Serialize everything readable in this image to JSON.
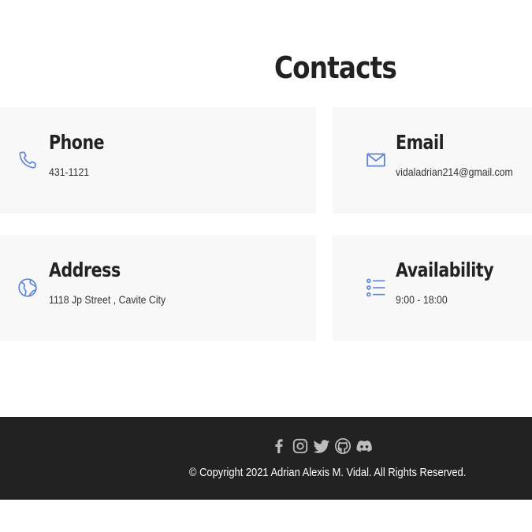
{
  "page": {
    "title": "Contacts"
  },
  "cards": {
    "phone": {
      "heading": "Phone",
      "value": "431-1121",
      "icon": "phone-icon"
    },
    "email": {
      "heading": "Email",
      "value": "vidaladrian214@gmail.com",
      "icon": "mail-icon"
    },
    "address": {
      "heading": "Address",
      "value": "1118 Jp Street , Cavite City",
      "icon": "globe-icon"
    },
    "availability": {
      "heading": "Availability",
      "value": "9:00 - 18:00",
      "icon": "list-icon"
    }
  },
  "footer": {
    "social": [
      "facebook-icon",
      "instagram-icon",
      "twitter-icon",
      "github-icon",
      "discord-icon"
    ],
    "copyright": "© Copyright 2021 Adrian Alexis M. Vidal. All Rights Reserved."
  },
  "colors": {
    "accent": "#5b83d6",
    "card_bg": "#f8f8f8",
    "footer_bg": "#222222",
    "social_icon": "#bdbdbd"
  }
}
